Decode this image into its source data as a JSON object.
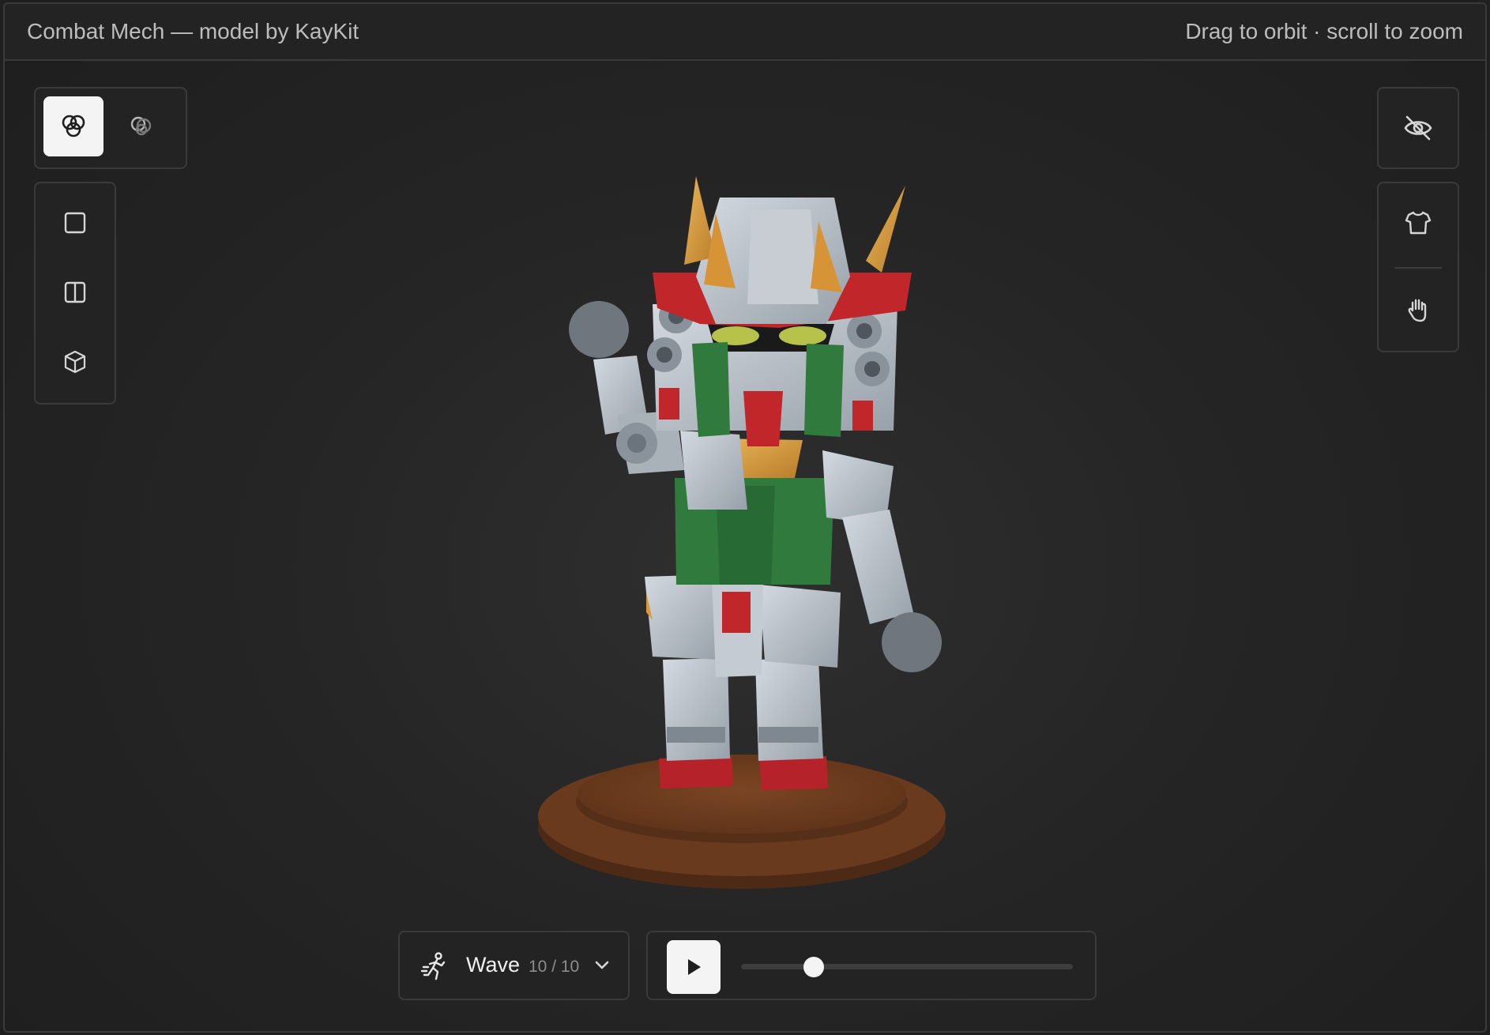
{
  "header": {
    "title": "Combat Mech — model by KayKit",
    "hint": "Drag to orbit · scroll to zoom"
  },
  "material_toggle": {
    "items": [
      {
        "icon": "material-channels-icon",
        "active": true
      },
      {
        "icon": "material-overlap-icon",
        "active": false
      }
    ]
  },
  "view_modes": {
    "items": [
      {
        "icon": "square-view-icon"
      },
      {
        "icon": "split-view-icon"
      },
      {
        "icon": "cube-view-icon"
      }
    ]
  },
  "right_tools": {
    "visibility_icon": "eye-off-icon",
    "items": [
      {
        "icon": "shirt-icon"
      },
      {
        "icon": "hand-icon"
      }
    ]
  },
  "animation": {
    "icon": "running-figure-icon",
    "name": "Wave",
    "count": "10 / 10",
    "dropdown_icon": "chevron-down-icon"
  },
  "playback": {
    "play_icon": "play-icon",
    "progress": 0.22
  },
  "colors": {
    "accent": "#f4f4f4",
    "panel": "#232323",
    "border": "#3a3a3a",
    "mech_body": "#b7bec6",
    "mech_red": "#c0262a",
    "mech_green": "#2f7a3c",
    "mech_gold": "#d79a3a",
    "base_brown": "#6a3a1e"
  }
}
